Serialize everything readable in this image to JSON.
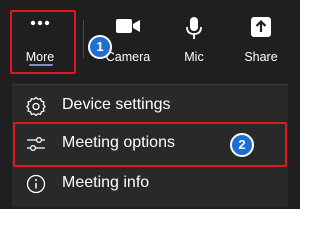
{
  "toolbar": {
    "more_label": "More",
    "camera_label": "Camera",
    "mic_label": "Mic",
    "share_label": "Share"
  },
  "menu": {
    "items": [
      {
        "label": "Device settings",
        "icon": "gear-icon"
      },
      {
        "label": "Meeting options",
        "icon": "sliders-icon"
      },
      {
        "label": "Meeting info",
        "icon": "info-icon"
      }
    ]
  },
  "callouts": {
    "step1": "1",
    "step2": "2"
  },
  "colors": {
    "background": "#1f1f1f",
    "menu_background": "#292929",
    "highlight_red": "#e0181e",
    "badge_blue": "#1d6fd6",
    "active_underline": "#8b8cc7"
  }
}
